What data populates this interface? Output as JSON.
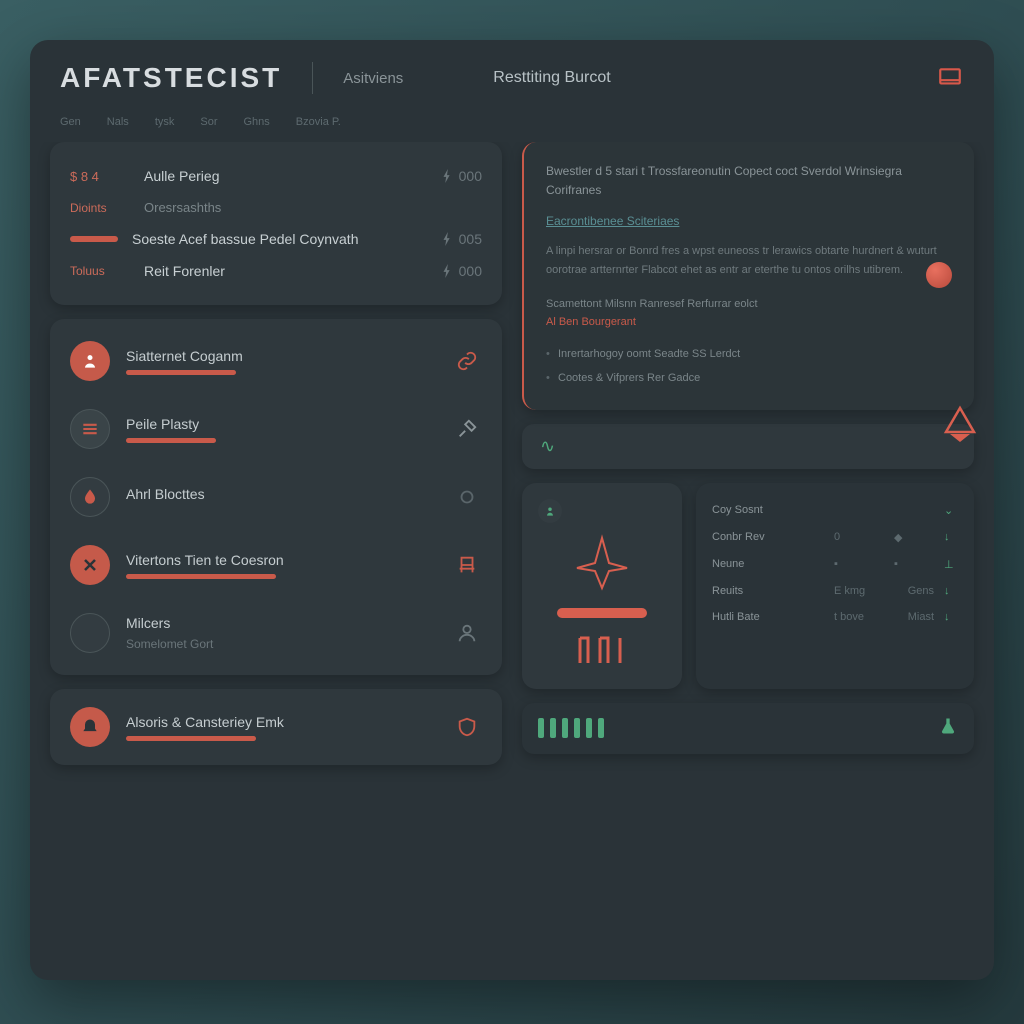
{
  "header": {
    "brand": "AFATSTECIST",
    "sub": "Asitviens",
    "mid": "Resttiting Burcot"
  },
  "tabs": [
    "Gen",
    "Nals",
    "tysk",
    "Sor",
    "Ghns",
    "Bzovia P."
  ],
  "stats": {
    "rows": [
      {
        "lead": "$ 8 4",
        "label": "Aulle Perieg",
        "val": "000"
      },
      {
        "lead": "Dioints",
        "label": "Oresrsashths",
        "val": ""
      },
      {
        "lead": "",
        "label": "Soeste Acef bassue Pedel Coynvath",
        "val": "005"
      },
      {
        "lead": "Toluus",
        "label": "Reit Forenler",
        "val": "000"
      }
    ]
  },
  "features": [
    {
      "title": "Siatternet Coganm",
      "icon": "person",
      "ico_color": "org",
      "rico": "link"
    },
    {
      "title": "Peile Plasty",
      "icon": "menu",
      "ico_color": "red",
      "rico": "tool"
    },
    {
      "title": "Ahrl Blocttes",
      "icon": "drop",
      "ico_color": "drk",
      "rico": "dot"
    },
    {
      "title": "Vitertons Tien te Coesron",
      "icon": "close",
      "ico_color": "org",
      "rico": "chair"
    },
    {
      "title": "Milcers",
      "sub": "Somelomet Gort",
      "icon": "blank",
      "ico_color": "drk",
      "rico": "user"
    }
  ],
  "bottom_feature": {
    "title": "Alsoris & Cansteriey Emk",
    "icon": "bell"
  },
  "panel": {
    "title": "Bwestler d 5 stari t Trossfareonutin Copect coct Sverdol Wrinsiegra Corifranes",
    "link": "Eacrontibenee Sciteriaes",
    "body": "A linpi hersrar or Bonrd fres a wpst euneoss tr lerawics obtarte hurdnert & wuturt oorotrae artternrter Flabcot ehet as entr ar eterthe tu ontos orilhs utibrem.",
    "sec": "Scamettont Milsnn Ranresef Rerfurrar eolct",
    "hl": "Al Ben Bourgerant",
    "li1": "Inrertarhogoy oomt Seadte SS Lerdct",
    "li2": "Cootes & Vifprers Rer Gadce"
  },
  "grid": {
    "head": "Coy Sosnt",
    "rows": [
      {
        "l": "Conbr Rev",
        "a": "0",
        "b": "◆",
        "c": ""
      },
      {
        "l": "Neune",
        "a": "",
        "b": "",
        "c": ""
      },
      {
        "l": "Reuits",
        "a": "E kmg",
        "b": "",
        "c": "Gens"
      },
      {
        "l": "Hutli Bate",
        "a": "t bove",
        "b": "",
        "c": "Miast"
      }
    ]
  }
}
